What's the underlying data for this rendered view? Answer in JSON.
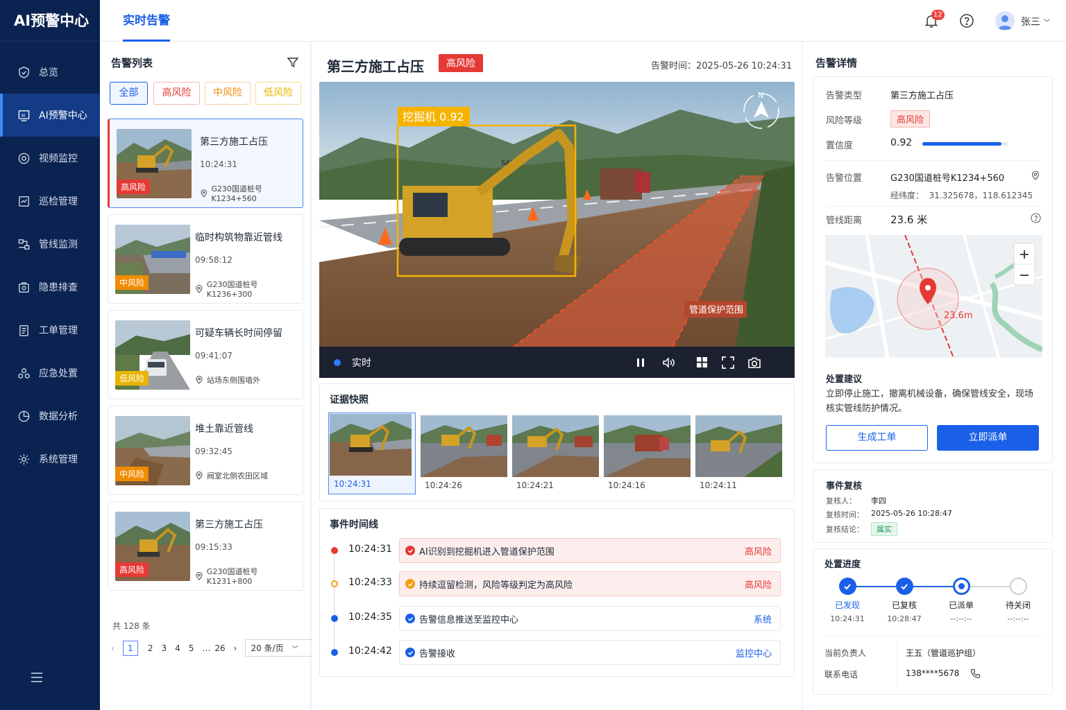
{
  "app": {
    "title": "AI预警中心"
  },
  "sidebar": {
    "items": [
      {
        "label": "总览",
        "icon": "shield-icon"
      },
      {
        "label": "AI预警中心",
        "icon": "ai-monitor-icon"
      },
      {
        "label": "视频监控",
        "icon": "camera-icon"
      },
      {
        "label": "巡检管理",
        "icon": "inspection-icon"
      },
      {
        "label": "管线监测",
        "icon": "pipeline-icon"
      },
      {
        "label": "隐患排查",
        "icon": "hazard-icon"
      },
      {
        "label": "工单管理",
        "icon": "workorder-icon"
      },
      {
        "label": "应急处置",
        "icon": "emergency-icon"
      },
      {
        "label": "数据分析",
        "icon": "chart-pie-icon"
      },
      {
        "label": "系统管理",
        "icon": "gear-icon"
      }
    ]
  },
  "header": {
    "tab": "实时告警",
    "notification_count": "12",
    "user": "张三"
  },
  "alert_list": {
    "title": "告警列表",
    "filters": [
      "全部",
      "高风险",
      "中风险",
      "低风险"
    ],
    "items": [
      {
        "title": "第三方施工占压",
        "time": "10:24:31",
        "location": "G230国道桩号K1234+560",
        "risk": "高风险"
      },
      {
        "title": "临时构筑物靠近管线",
        "time": "09:58:12",
        "location": "G230国道桩号K1236+300",
        "risk": "中风险"
      },
      {
        "title": "可疑车辆长时间停留",
        "time": "09:41:07",
        "location": "站场东侧围墙外",
        "risk": "低风险"
      },
      {
        "title": "堆土靠近管线",
        "time": "09:32:45",
        "location": "阀室北侧农田区域",
        "risk": "中风险"
      },
      {
        "title": "第三方施工占压",
        "time": "09:15:33",
        "location": "G230国道桩号K1231+800",
        "risk": "高风险"
      }
    ],
    "total": "共 128 条",
    "pages": [
      "1",
      "2",
      "3",
      "4",
      "5",
      "…",
      "26"
    ],
    "page_size": "20 条/页"
  },
  "main": {
    "title": "第三方施工占压",
    "risk": "高风险",
    "alert_time_label": "告警时间：",
    "alert_time": "2025-05-26  10:24:31",
    "video": {
      "detection_label": "挖掘机 0.92",
      "zone_label": "管道保护范围",
      "status": "实时",
      "excavator_brand": "SANY",
      "compass": "N"
    },
    "evidence": {
      "title": "证据快照",
      "snapshots": [
        "10:24:31",
        "10:24:26",
        "10:24:21",
        "10:24:16",
        "10:24:11"
      ]
    },
    "timeline": {
      "title": "事件时间线",
      "events": [
        {
          "time": "10:24:31",
          "text": "AI识别到挖掘机进入管道保护范围",
          "tag": "高风险",
          "color": "#e53935"
        },
        {
          "time": "10:24:33",
          "text": "持续逗留检测，风险等级判定为高风险",
          "tag": "高风险",
          "color": "#f59e0b"
        },
        {
          "time": "10:24:35",
          "text": "告警信息推送至监控中心",
          "tag": "系统",
          "color": "#1a5fe8"
        },
        {
          "time": "10:24:42",
          "text": "告警接收",
          "tag": "监控中心",
          "color": "#1a5fe8"
        }
      ]
    }
  },
  "detail": {
    "title": "告警详情",
    "type_label": "告警类型",
    "type": "第三方施工占压",
    "level_label": "风险等级",
    "level": "高风险",
    "confidence_label": "置信度",
    "confidence": "0.92",
    "confidence_value": 0.92,
    "location_label": "告警位置",
    "location": "G230国道桩号K1234+560",
    "coords_label": "经纬度：",
    "coords": "31.325678，118.612345",
    "distance_label": "管线距离",
    "distance": "23.6 米",
    "map_distance": "23.6m",
    "advice_title": "处置建议",
    "advice": "立即停止施工，撤离机械设备，确保管线安全，现场核实管线防护情况。",
    "btn_create": "生成工单",
    "btn_dispatch": "立即派单"
  },
  "review": {
    "title": "事件复核",
    "reviewer_label": "复核人：",
    "reviewer": "李四",
    "time_label": "复核时间：",
    "time": "2025-05-26 10:28:47",
    "result_label": "复核结论：",
    "result": "属实"
  },
  "progress": {
    "title": "处置进度",
    "steps": [
      {
        "label": "已发现",
        "time": "10:24:31"
      },
      {
        "label": "已复核",
        "time": "10:28:47"
      },
      {
        "label": "已派单",
        "time": "--:--:--"
      },
      {
        "label": "待关闭",
        "time": "--:--:--"
      }
    ],
    "owner_label": "当前负责人",
    "owner": "王五（管道巡护组）",
    "phone_label": "联系电话",
    "phone": "138****5678"
  }
}
